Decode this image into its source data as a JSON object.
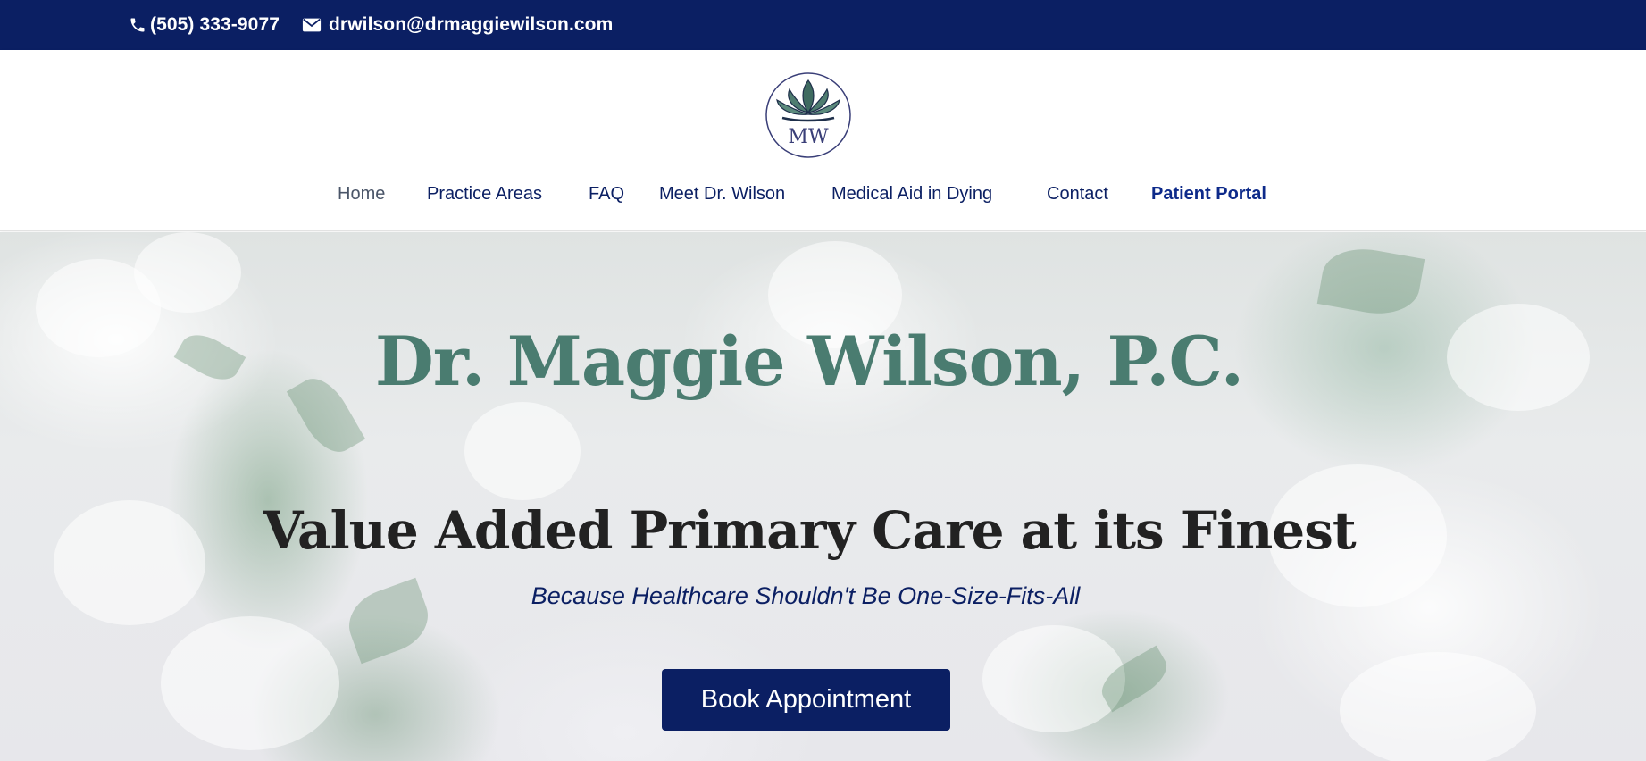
{
  "topbar": {
    "phone": "(505) 333-9077",
    "phone_icon": "phone-icon",
    "email": "drwilson@drmaggiewilson.com",
    "email_icon": "envelope-icon"
  },
  "logo": {
    "monogram": "MW",
    "icon": "lotus-icon"
  },
  "nav": {
    "items": [
      {
        "label": "Home",
        "active": true
      },
      {
        "label": "Practice Areas"
      },
      {
        "label": "FAQ"
      },
      {
        "label": "Meet Dr. Wilson"
      },
      {
        "label": "Medical Aid in Dying"
      },
      {
        "label": "Contact"
      },
      {
        "label": "Patient Portal",
        "highlight": true
      }
    ]
  },
  "hero": {
    "title": "Dr. Maggie Wilson, P.C.",
    "subtitle": "Value Added Primary Care at its Finest",
    "tagline": "Because Healthcare Shouldn't Be One-Size-Fits-All",
    "cta": "Book Appointment"
  },
  "colors": {
    "brand_navy": "#0b1f63",
    "brand_green": "#4a7c70",
    "heading_dark": "#222222"
  }
}
